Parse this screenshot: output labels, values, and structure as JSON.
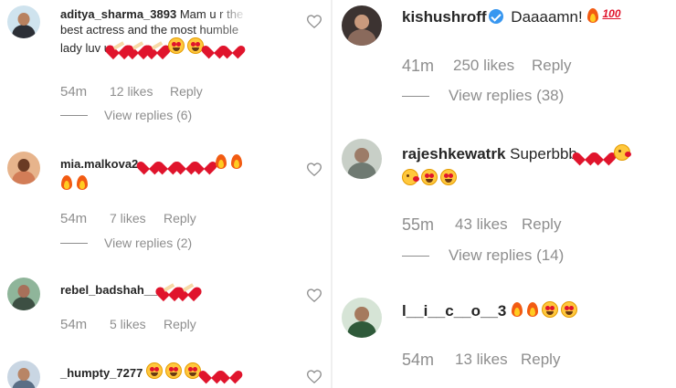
{
  "left_column": [
    {
      "username": "aditya_sharma_3893",
      "text_line1": "Mam u r the",
      "text_line2": "best actress and the most humble",
      "text_line3": "lady luv u",
      "emojis": [
        "heart-hurt-icon",
        "heart-hurt-icon",
        "heart-hurt-icon",
        "heart-eyes-icon",
        "heart-eyes-icon",
        "red-heart-icon",
        "red-heart-icon"
      ],
      "time": "54m",
      "likes": "12 likes",
      "reply": "Reply",
      "view_replies": "View replies (6)"
    },
    {
      "username": "mia.malkova2",
      "emojis": [
        "red-heart-icon",
        "red-heart-icon",
        "red-heart-icon",
        "red-heart-icon",
        "fire-icon",
        "fire-icon",
        "fire-icon",
        "fire-icon"
      ],
      "time": "54m",
      "likes": "7 likes",
      "reply": "Reply",
      "view_replies": "View replies (2)"
    },
    {
      "username": "rebel_badshah__",
      "emojis": [
        "heart-hurt-icon",
        "heart-hurt-icon"
      ],
      "time": "54m",
      "likes": "5 likes",
      "reply": "Reply"
    },
    {
      "username": "_humpty_7277",
      "emojis": [
        "heart-eyes-icon",
        "heart-eyes-icon",
        "heart-eyes-icon",
        "red-heart-icon",
        "red-heart-icon"
      ]
    }
  ],
  "right_column": [
    {
      "username": "kishushroff",
      "verified": true,
      "text": "Daaaamn!",
      "emojis": [
        "fire-icon",
        "hundred-icon"
      ],
      "time": "41m",
      "likes": "250 likes",
      "reply": "Reply",
      "view_replies": "View replies (38)"
    },
    {
      "username": "rajeshkewatrk",
      "text": "Superbbb",
      "emojis": [
        "red-heart-icon",
        "red-heart-icon",
        "kiss-face-icon",
        "kiss-face-icon",
        "heart-eyes-icon",
        "heart-eyes-icon"
      ],
      "time": "55m",
      "likes": "43 likes",
      "reply": "Reply",
      "view_replies": "View replies (14)"
    },
    {
      "username": "l__i__c__o__3",
      "emojis": [
        "fire-icon",
        "fire-icon",
        "heart-eyes-icon",
        "heart-eyes-icon"
      ],
      "time": "54m",
      "likes": "13 likes",
      "reply": "Reply"
    }
  ],
  "colors": {
    "text": "#262626",
    "meta": "#8e8e8e",
    "heart": "#e0142c",
    "verified": "#3897f0"
  }
}
